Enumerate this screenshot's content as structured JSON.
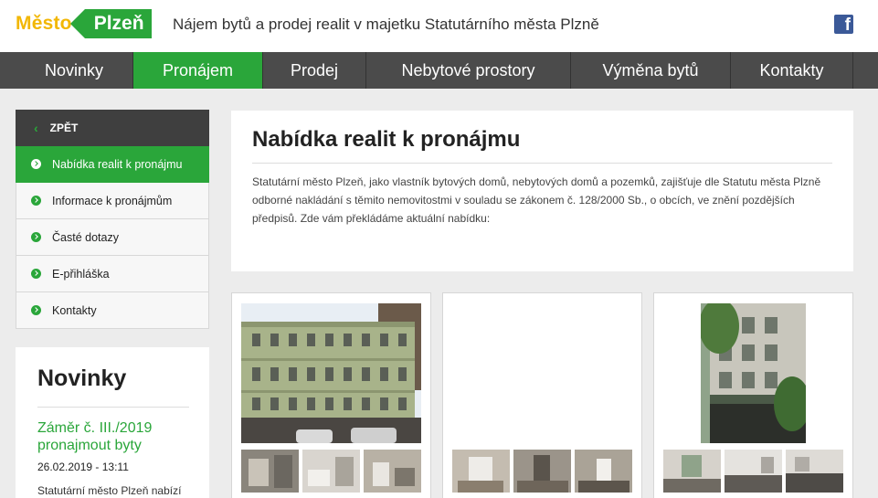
{
  "header": {
    "logo_mesto": "Město",
    "logo_plzen": "Plzeň",
    "title": "Nájem bytů a prodej realit v majetku Statutárního města Plzně",
    "facebook_icon": "facebook-icon"
  },
  "nav": {
    "items": [
      {
        "label": "Novinky"
      },
      {
        "label": "Pronájem"
      },
      {
        "label": "Prodej"
      },
      {
        "label": "Nebytové prostory"
      },
      {
        "label": "Výměna bytů"
      },
      {
        "label": "Kontakty"
      }
    ],
    "active": "Pronájem"
  },
  "sidebar": {
    "back_label": "ZPĚT",
    "items": [
      {
        "label": "Nabídka realit k pronájmu"
      },
      {
        "label": "Informace k pronájmům"
      },
      {
        "label": "Časté dotazy"
      },
      {
        "label": "E-přihláška"
      },
      {
        "label": "Kontakty"
      }
    ],
    "active": "Nabídka realit k pronájmu"
  },
  "news": {
    "title": "Novinky",
    "item_title": "Záměr č. III./2019 pronajmout byty",
    "item_date": "26.02.2019 - 13:11",
    "item_text": "Statutární město Plzeň nabízí"
  },
  "main": {
    "title": "Nabídka realit k pronájmu",
    "text": "Statutární město Plzeň, jako vlastník bytových domů, nebytových domů a pozemků, zajišťuje dle Statutu města Plzně odborné nakládání s těmito nemovitostmi v souladu se zákonem č. 128/2000 Sb., o obcích, ve znění pozdějších předpisů. Zde vám překládáme aktuální nabídku:"
  },
  "colors": {
    "brand_green": "#2aa63a",
    "brand_yellow": "#f2b705",
    "nav_bg": "#4b4b4b",
    "facebook_blue": "#3b5998"
  }
}
